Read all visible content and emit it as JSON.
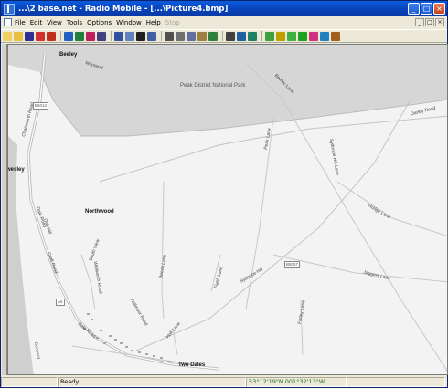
{
  "window": {
    "title": "...\\2 base.net - Radio Mobile - [...\\Picture4.bmp]",
    "buttons": {
      "minimize": "_",
      "maximize": "□",
      "close": "×"
    }
  },
  "menu": {
    "items": [
      {
        "label": "File",
        "enabled": true
      },
      {
        "label": "Edit",
        "enabled": true
      },
      {
        "label": "View",
        "enabled": true
      },
      {
        "label": "Tools",
        "enabled": true
      },
      {
        "label": "Options",
        "enabled": true
      },
      {
        "label": "Window",
        "enabled": true
      },
      {
        "label": "Help",
        "enabled": true
      },
      {
        "label": "Stop",
        "enabled": false
      }
    ],
    "mdi_buttons": [
      "_",
      "□",
      "×"
    ]
  },
  "toolbar": {
    "icons": [
      {
        "name": "new-icon",
        "color": "#f0d060"
      },
      {
        "name": "open-icon",
        "color": "#e8c040"
      },
      {
        "name": "save-icon",
        "color": "#303090"
      },
      {
        "name": "network-icon",
        "color": "#d03030"
      },
      {
        "name": "unit-icon",
        "color": "#c03020"
      },
      {
        "name": "sep"
      },
      {
        "name": "globe-icon",
        "color": "#2060c0"
      },
      {
        "name": "map-icon",
        "color": "#208040"
      },
      {
        "name": "radar-icon",
        "color": "#c02060"
      },
      {
        "name": "target-icon",
        "color": "#404080"
      },
      {
        "name": "sep"
      },
      {
        "name": "grid-icon",
        "color": "#3050a0"
      },
      {
        "name": "page-icon",
        "color": "#6080c0"
      },
      {
        "name": "film-icon",
        "color": "#202020"
      },
      {
        "name": "picture-icon",
        "color": "#4060a0"
      },
      {
        "name": "sep"
      },
      {
        "name": "print-icon",
        "color": "#505050"
      },
      {
        "name": "copy-icon",
        "color": "#707070"
      },
      {
        "name": "paste-icon",
        "color": "#6070a0"
      },
      {
        "name": "layers-icon",
        "color": "#a08040"
      },
      {
        "name": "export-icon",
        "color": "#308040"
      },
      {
        "name": "sep"
      },
      {
        "name": "frame-icon",
        "color": "#404040"
      },
      {
        "name": "zoom-icon",
        "color": "#2060a0"
      },
      {
        "name": "measure-icon",
        "color": "#208060"
      },
      {
        "name": "sep"
      },
      {
        "name": "antenna-icon",
        "color": "#40a040"
      },
      {
        "name": "signal-icon",
        "color": "#c0a000"
      },
      {
        "name": "coverage-icon",
        "color": "#40b040"
      },
      {
        "name": "link-icon",
        "color": "#20a020"
      },
      {
        "name": "route-icon",
        "color": "#d03080"
      },
      {
        "name": "world-icon",
        "color": "#2080c0"
      },
      {
        "name": "info-icon",
        "color": "#a06020"
      }
    ]
  },
  "map": {
    "park_label": "Peak District National Park",
    "places": {
      "beeley": "Beeley",
      "wesley": "wesley",
      "northwood": "Northwood",
      "two_dales": "Two Dales"
    },
    "roads": {
      "moorend": "Moorend",
      "beeley_lane": "Beeley Lane",
      "darley_road": "Darley Road",
      "chatsworth_road": "Chatsworth Road",
      "peak_lane": "Peak Lane",
      "sydnope_hill_lane": "Sydnope Hill Lane",
      "dale_road": "Dale Road",
      "oak_hill": "Oak Hill",
      "south_view": "South View",
      "croft_road": "Croft Road",
      "whitworth_road": "Whitworth Road",
      "broad_walk": "Broad Walk",
      "hodge_lane": "Hodge Lane",
      "summer_hill": "Sydnope Hill",
      "jaggers_lane": "Jaggers Lane",
      "beech_lane": "Beech Lane",
      "farley_lane": "Farley Lane",
      "flash_lane": "Flash Lane",
      "hallmoor_road": "Hallmoor Road",
      "dale_road_s": "Dale Road",
      "holt_lane": "Holt Lane",
      "beam_lane": "Beam Lane"
    },
    "shields": {
      "b5012": "B5012",
      "a6": "A6",
      "b5057": "B5057"
    },
    "river": "Derwent",
    "colors": {
      "background": "#f3f3f3",
      "park": "#d6d6d6",
      "road": "#bdbdbd",
      "water": "#cfcfcf"
    }
  },
  "status": {
    "left": "",
    "state": "Ready",
    "coords": "53°12'19\"N 001°32'13\"W",
    "right": ""
  }
}
